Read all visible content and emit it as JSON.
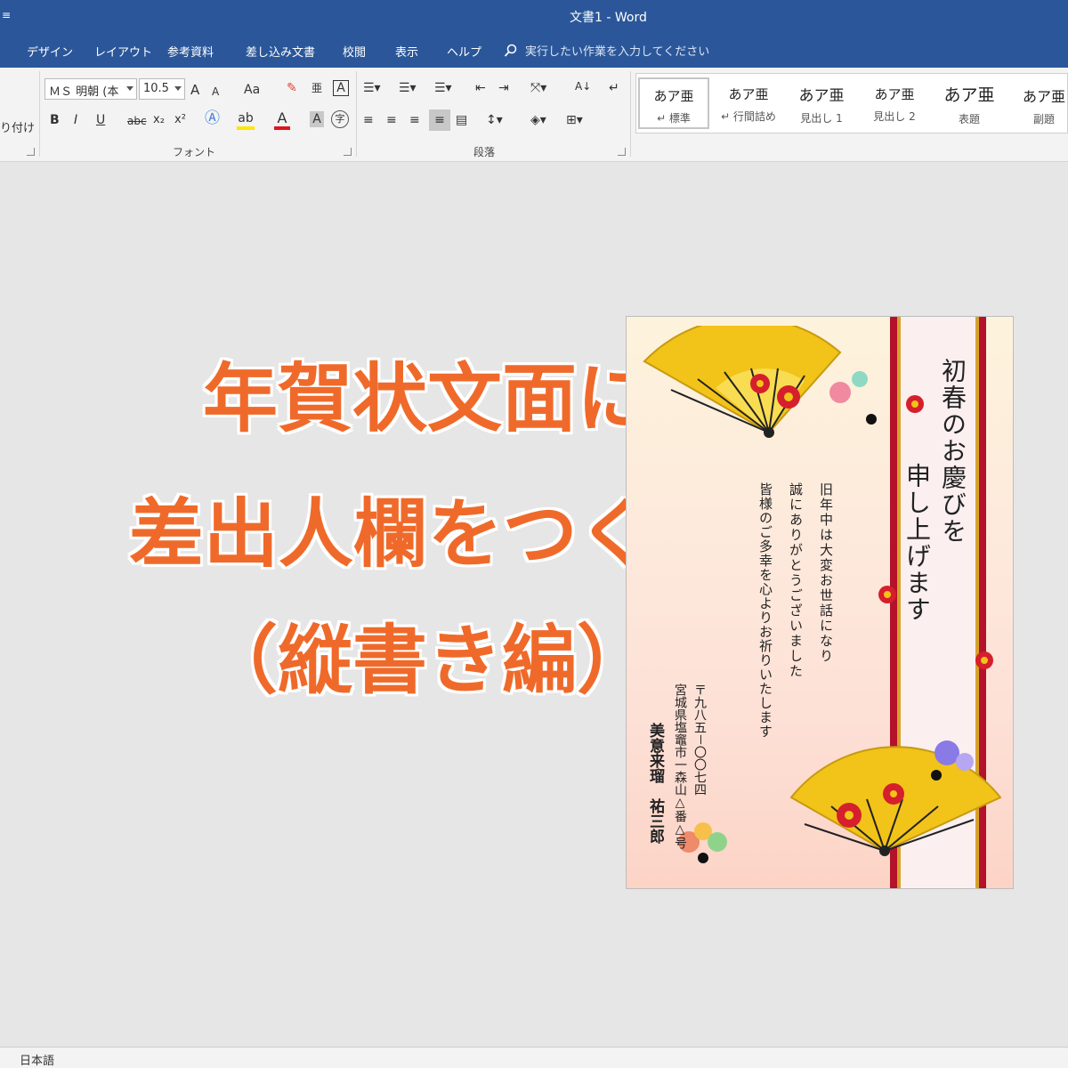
{
  "window": {
    "title": "文書1 - Word"
  },
  "tabs": [
    "デザイン",
    "レイアウト",
    "参考資料",
    "差し込み文書",
    "校閲",
    "表示",
    "ヘルプ"
  ],
  "tell_me": {
    "placeholder": "実行したい作業を入力してください"
  },
  "ribbon": {
    "clipboard_partial_label": "り付け",
    "font": {
      "name": "ＭＳ 明朝 (本",
      "size": "10.5",
      "group_label": "フォント",
      "bold": "B",
      "italic": "I",
      "underline": "U",
      "strike": "abc",
      "subscript": "x₂",
      "superscript": "x²",
      "case": "Aa",
      "grow": "A",
      "shrink": "A",
      "phonetic": "亜",
      "border_char": "A",
      "shade_char": "A",
      "enclose": "字"
    },
    "paragraph": {
      "group_label": "段落"
    },
    "styles": [
      {
        "sample": "あア亜",
        "name": "↵ 標準"
      },
      {
        "sample": "あア亜",
        "name": "↵ 行間詰め"
      },
      {
        "sample": "あア亜",
        "name": "見出し 1"
      },
      {
        "sample": "あア亜",
        "name": "見出し 2"
      },
      {
        "sample": "あア亜",
        "name": "表題"
      },
      {
        "sample": "あア亜",
        "name": "副題"
      }
    ]
  },
  "status": {
    "language": "日本語"
  },
  "headline": {
    "line1": "年賀状文面に",
    "line2": "差出人欄をつくる",
    "line3": "（縦書き編）"
  },
  "card": {
    "greeting_col1": "初春のお慶びを",
    "greeting_col2": "申し上げます",
    "body_col1": "旧年中は大変お世話になり",
    "body_col2": "誠にありがとうございました",
    "body_col3": "皆様のご多幸を心よりお祈りいたします",
    "postal": "〒九八五－〇〇七四",
    "address": "宮城県塩竈市一森山△番△号",
    "names": "美意来瑠　祐三郎",
    "colors": {
      "ribbon_red": "#b3122a",
      "gold": "#f2c318",
      "plum": "#d61f2c"
    }
  }
}
